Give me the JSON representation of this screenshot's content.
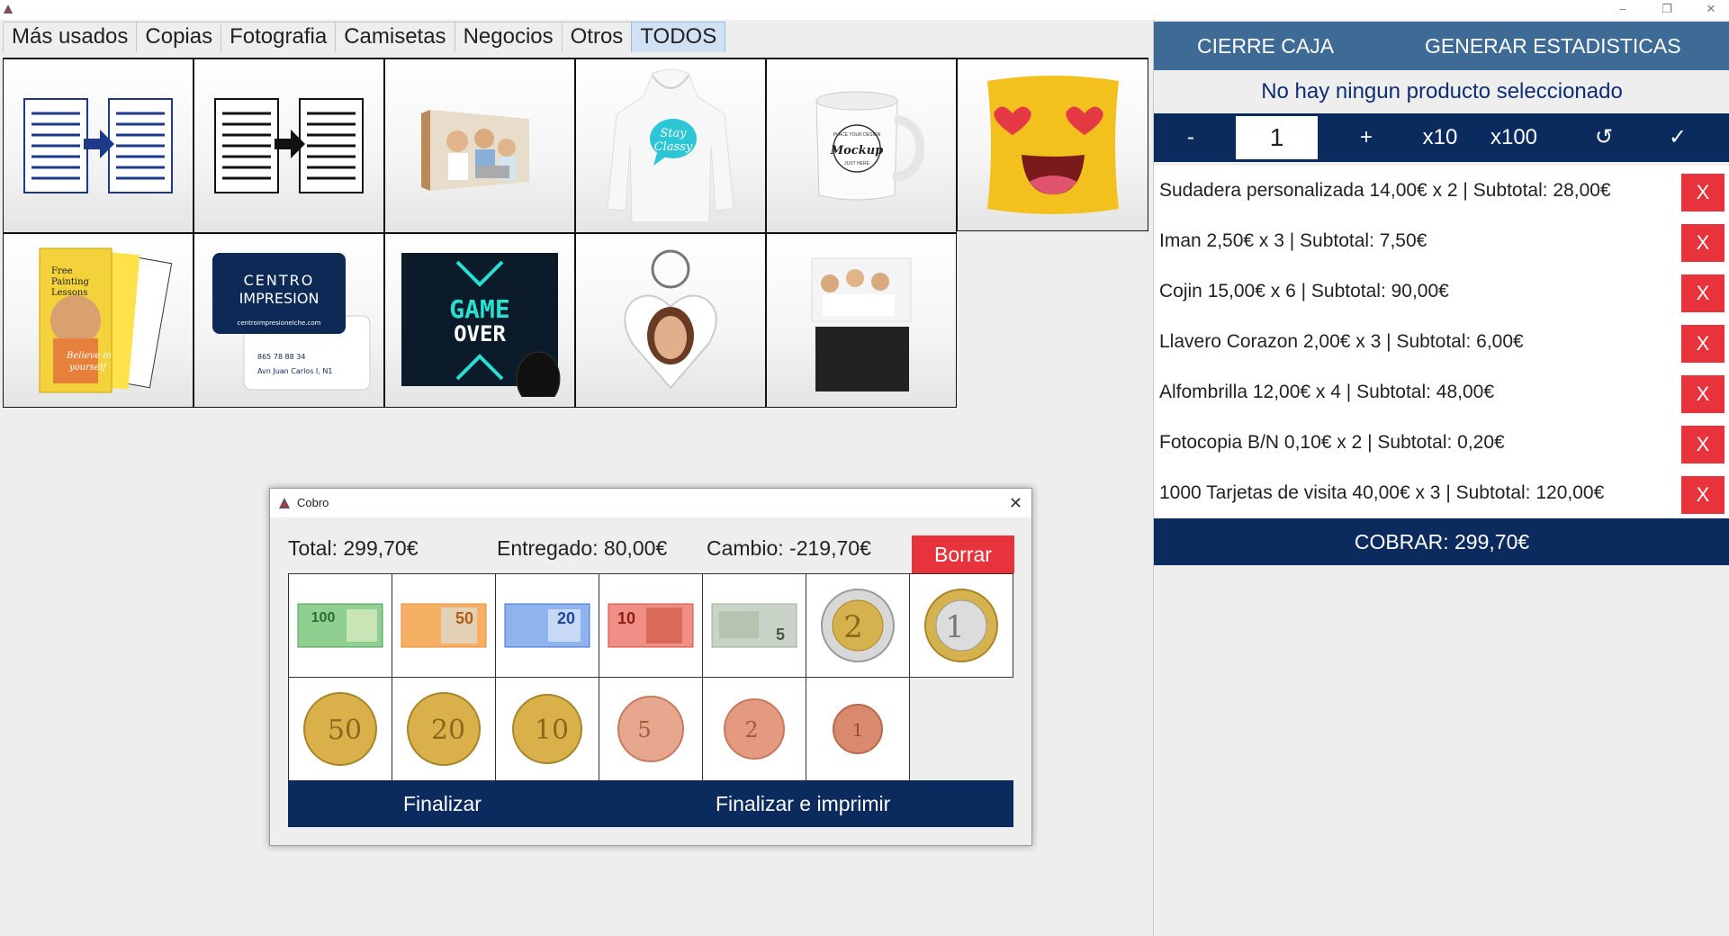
{
  "window": {
    "minimize": "–",
    "restore": "❐",
    "close": "✕"
  },
  "tabs": [
    {
      "label": "Más usados"
    },
    {
      "label": "Copias"
    },
    {
      "label": "Fotografia"
    },
    {
      "label": "Camisetas"
    },
    {
      "label": "Negocios"
    },
    {
      "label": "Otros"
    },
    {
      "label": "TODOS"
    }
  ],
  "products": [
    {
      "name": "fotocopia-color",
      "icon": "copy-color-icon"
    },
    {
      "name": "fotocopia-bn",
      "icon": "copy-bw-icon"
    },
    {
      "name": "foto-lienzo",
      "icon": "photo-canvas-icon"
    },
    {
      "name": "sudadera-personalizada",
      "icon": "hoodie-icon",
      "print": [
        "Stay",
        "Classy"
      ]
    },
    {
      "name": "taza",
      "icon": "mug-icon",
      "print": [
        "PLACE YOUR DESIGN",
        "Mockup",
        "JUST HERE"
      ]
    },
    {
      "name": "cojin",
      "icon": "cushion-icon"
    },
    {
      "name": "flyers",
      "icon": "flyers-icon",
      "print": [
        "Free",
        "Painting",
        "Lessons",
        "Believe in",
        "yourself"
      ]
    },
    {
      "name": "tarjetas-de-visita",
      "icon": "business-card-icon",
      "print": [
        "CENTRO",
        "IMPRESION",
        "centroimpresionelche.com",
        "865 78 88 34",
        "Avn Juan Carlos I, N1"
      ]
    },
    {
      "name": "alfombrilla",
      "icon": "mousepad-icon",
      "print": [
        "GAME",
        "OVER"
      ]
    },
    {
      "name": "llavero-corazon",
      "icon": "keychain-icon"
    },
    {
      "name": "iman",
      "icon": "magnet-icon"
    }
  ],
  "right": {
    "cierre_caja": "CIERRE CAJA",
    "generar_estadisticas": "GENERAR ESTADISTICAS",
    "status": "No hay ningun producto seleccionado",
    "qty": {
      "minus": "-",
      "value": "1",
      "plus": "+",
      "x10": "x10",
      "x100": "x100",
      "reset": "↺",
      "confirm": "✓"
    },
    "items": [
      {
        "text": "Sudadera personalizada 14,00€ x 2 | Subtotal: 28,00€",
        "remove": "X"
      },
      {
        "text": "Iman 2,50€ x 3 | Subtotal: 7,50€",
        "remove": "X"
      },
      {
        "text": "Cojin 15,00€ x 6 | Subtotal: 90,00€",
        "remove": "X"
      },
      {
        "text": "Llavero Corazon 2,00€ x 3 | Subtotal: 6,00€",
        "remove": "X"
      },
      {
        "text": "Alfombrilla 12,00€ x 4 | Subtotal: 48,00€",
        "remove": "X"
      },
      {
        "text": "Fotocopia B/N 0,10€ x 2 | Subtotal: 0,20€",
        "remove": "X"
      },
      {
        "text": "1000 Tarjetas de visita 40,00€ x 3 | Subtotal: 120,00€",
        "remove": "X"
      }
    ],
    "cobrar": "COBRAR: 299,70€"
  },
  "dialog": {
    "title": "Cobro",
    "close": "✕",
    "total": "Total: 299,70€",
    "entregado": "Entregado: 80,00€",
    "cambio": "Cambio: -219,70€",
    "borrar": "Borrar",
    "finalizar": "Finalizar",
    "finalizar_imprimir": "Finalizar e imprimir",
    "money": [
      {
        "name": "billete-100",
        "label": "100",
        "color": "#4e9a5a"
      },
      {
        "name": "billete-50",
        "label": "50",
        "color": "#e68a2e"
      },
      {
        "name": "billete-20",
        "label": "20",
        "color": "#3d6fd0"
      },
      {
        "name": "billete-10",
        "label": "10",
        "color": "#d94a3a"
      },
      {
        "name": "billete-5",
        "label": "5",
        "color": "#9aa89a"
      },
      {
        "name": "moneda-2",
        "label": "2",
        "color": "#c9a64a"
      },
      {
        "name": "moneda-1",
        "label": "1",
        "color": "#d2b25a"
      },
      {
        "name": "moneda-050",
        "label": "50",
        "color": "#d9b04a"
      },
      {
        "name": "moneda-020",
        "label": "20",
        "color": "#d9b04a"
      },
      {
        "name": "moneda-010",
        "label": "10",
        "color": "#d9b04a"
      },
      {
        "name": "moneda-005",
        "label": "5",
        "color": "#c87a5e"
      },
      {
        "name": "moneda-002",
        "label": "2",
        "color": "#c87a5e"
      },
      {
        "name": "moneda-001",
        "label": "1",
        "color": "#c06a4e"
      }
    ]
  }
}
